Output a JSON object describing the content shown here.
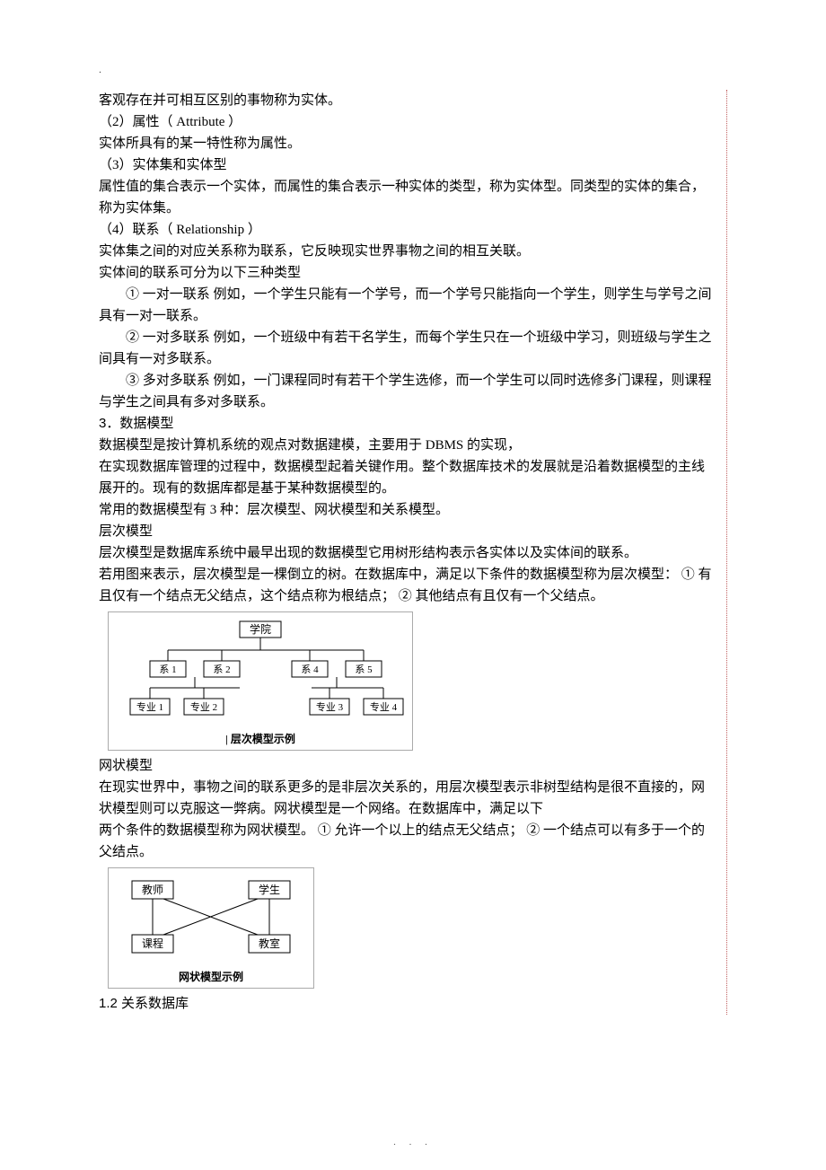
{
  "dot_mark": ".",
  "footer": ".   .   .",
  "paras": {
    "p0": "客观存在并可相互区别的事物称为实体。",
    "p1": "（2）属性（ Attribute  ）",
    "p2": "实体所具有的某一特性称为属性。",
    "p3": "（3）实体集和实体型",
    "p4": "属性值的集合表示一个实体，而属性的集合表示一种实体的类型，称为实体型。同类型的实体的集合，称为实体集。",
    "p5": "（4）联系（ Relationship  ）",
    "p6": "实体集之间的对应关系称为联系，它反映现实世界事物之间的相互关联。",
    "p7": "实体间的联系可分为以下三种类型",
    "p8": "①   一对一联系                  例如，一个学生只能有一个学号，而一个学号只能指向一个学生，则学生与学号之间具有一对一联系。",
    "p9": "②   一对多联系                  例如，一个班级中有若干名学生，而每个学生只在一个班级中学习，则班级与学生之间具有一对多联系。",
    "p10": "③   多对多联系                  例如，一门课程同时有若干个学生选修，而一个学生可以同时选修多门课程，则课程与学生之间具有多对多联系。",
    "p11": "3．数据模型",
    "p12": "数据模型是按计算机系统的观点对数据建模，主要用于          DBMS 的实现，",
    "p13": "在实现数据库管理的过程中，数据模型起着关键作用。整个数据库技术的发展就是沿着数据模型的主线展开的。现有的数据库都是基于某种数据模型的。",
    "p14": "常用的数据模型有   3 种：层次模型、网状模型和关系模型。",
    "p15": "层次模型",
    "p16": "层次模型是数据库系统中最早出现的数据模型它用树形结构表示各实体以及实体间的联系。",
    "p17": "若用图来表示，层次模型是一棵倒立的树。在数据库中，满足以下条件的数据模型称为层次模型：   ①   有且仅有一个结点无父结点，这个结点称为根结点；          ②   其他结点有且仅有一个父结点。",
    "p18": "网状模型",
    "p19": "在现实世界中，事物之间的联系更多的是非层次关系的，用层次模型表示非树型结构是很不直接的，网状模型则可以克服这一弊病。网状模型是一个网络。在数据库中，满足以下",
    "p20": "两个条件的数据模型称为网状模型。  ① 允许一个以上的结点无父结点；  ② 一个结点可以有多于一个的父结点。",
    "p21": "1.2   关系数据库"
  },
  "diagram1": {
    "root": "学院",
    "level2": [
      "系 1",
      "系 2",
      "系 4",
      "系 5"
    ],
    "level3": [
      "专业 1",
      "专业 2",
      "专业 3",
      "专业 4"
    ],
    "caption": "| 层次模型示例"
  },
  "diagram2": {
    "nodes": [
      "教师",
      "学生",
      "课程",
      "教室"
    ],
    "caption": "网状模型示例"
  }
}
